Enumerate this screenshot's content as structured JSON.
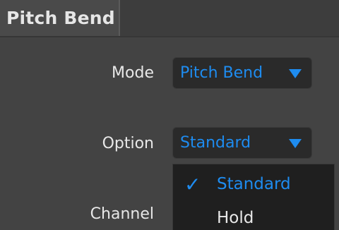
{
  "tab": {
    "title": "Pitch Bend"
  },
  "fields": {
    "mode": {
      "label": "Mode",
      "value": "Pitch Bend"
    },
    "option": {
      "label": "Option",
      "value": "Standard"
    },
    "channel": {
      "label": "Channel"
    }
  },
  "option_menu": {
    "items": [
      {
        "label": "Standard",
        "checked": true,
        "check_glyph": "✓"
      },
      {
        "label": "Hold",
        "checked": false
      }
    ]
  },
  "colors": {
    "accent": "#1e8cf0",
    "panel_bg": "#434343",
    "dropdown_bg": "#2a2a2a",
    "menu_bg": "#1f1f1f",
    "label_text": "#e8e8e8"
  }
}
